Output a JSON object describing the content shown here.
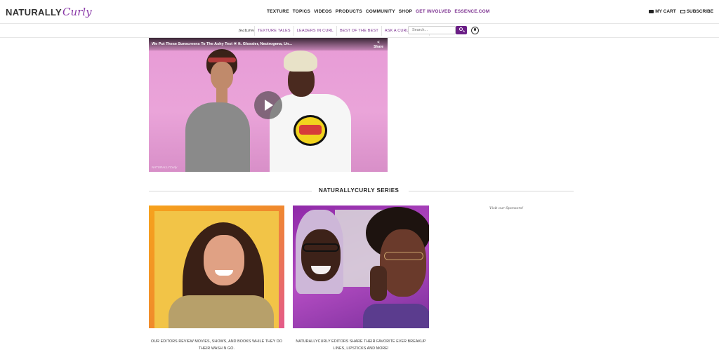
{
  "brand": {
    "part1": "NATURALLY",
    "part2": "Curly"
  },
  "main_nav": [
    "TEXTURE",
    "TOPICS",
    "VIDEOS",
    "PRODUCTS",
    "COMMUNITY",
    "SHOP",
    "GET INVOLVED",
    "ESSENCE.COM"
  ],
  "utility": {
    "cart": "MY CART",
    "subscribe": "SUBSCRIBE"
  },
  "sub_nav": {
    "features_label": "features",
    "items": [
      "TEXTURE TALES",
      "LEADERS IN CURL",
      "BEST OF THE BEST",
      "ASK A CURL EXPERT"
    ],
    "search_placeholder": "Search..."
  },
  "video": {
    "title": "We Put These Sunscreens To The Ashy Test ☀ ft. Glossier, Neutrogena, Un...",
    "share_label": "Share",
    "watermark": "NATURALLYCurly"
  },
  "series": {
    "heading": "NATURALLYCURLY SERIES"
  },
  "sponsor_text": "Visit our Sponsors!",
  "cards": [
    {
      "caption_line1": "OUR EDITORS REVIEW MOVIES, SHOWS, AND BOOKS WHILE THEY DO",
      "caption_line2": "THEIR WASH N GO."
    },
    {
      "caption_line1": "NATURALLYCURLY EDITORS SHARE THEIR FAVORITE EVER BREAKUP",
      "caption_line2": "LINES, LIPSTICKS AND MORE!"
    }
  ],
  "colors": {
    "brand_purple": "#6b1f86",
    "accent_link": "#7b2f8f",
    "divider": "#e6e6e6"
  }
}
